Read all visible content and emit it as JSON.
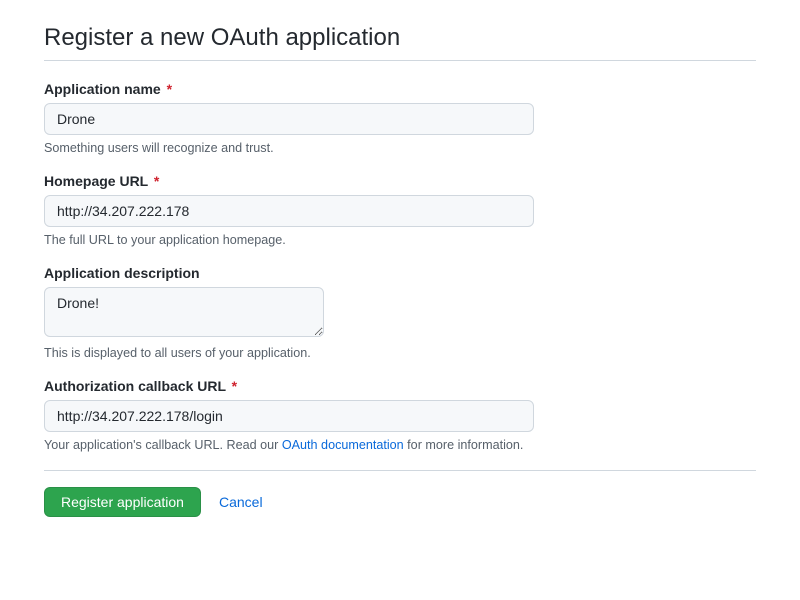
{
  "page_title": "Register a new OAuth application",
  "fields": {
    "app_name": {
      "label": "Application name",
      "value": "Drone",
      "hint": "Something users will recognize and trust."
    },
    "homepage_url": {
      "label": "Homepage URL",
      "value": "http://34.207.222.178",
      "hint": "The full URL to your application homepage."
    },
    "description": {
      "label": "Application description",
      "value": "Drone!",
      "hint": "This is displayed to all users of your application."
    },
    "callback_url": {
      "label": "Authorization callback URL",
      "value": "http://34.207.222.178/login",
      "hint_prefix": "Your application's callback URL. Read our ",
      "hint_link_text": "OAuth documentation",
      "hint_suffix": " for more information."
    }
  },
  "required_marker": "*",
  "actions": {
    "register_label": "Register application",
    "cancel_label": "Cancel"
  }
}
